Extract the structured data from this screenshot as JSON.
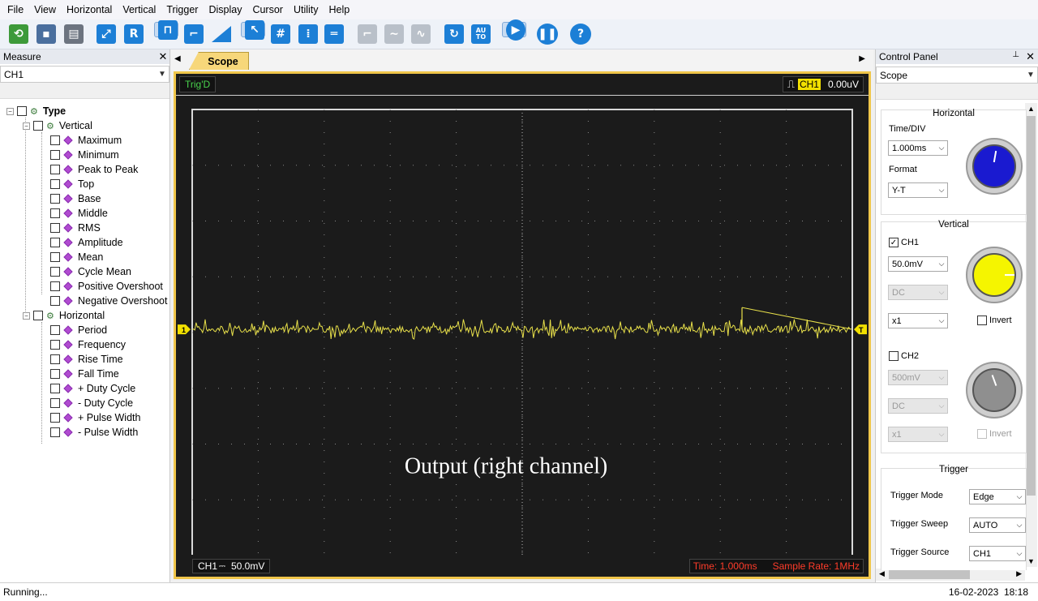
{
  "menu": [
    "File",
    "View",
    "Horizontal",
    "Vertical",
    "Trigger",
    "Display",
    "Cursor",
    "Utility",
    "Help"
  ],
  "toolbar_icons": [
    "open-icon",
    "save-icon",
    "print-icon",
    "autoscale-icon",
    "reset-icon",
    "pulse-icon",
    "step-icon",
    "ramp-icon",
    "pointer-icon",
    "grid-icon",
    "vertical-cursor-icon",
    "horizontal-cursor-icon",
    "step-gray-icon",
    "wave-gray-icon",
    "sine-gray-icon",
    "refresh-icon",
    "auto-icon",
    "run-icon",
    "pause-icon",
    "help-icon"
  ],
  "toolbar_labels": {
    "reset": "R",
    "auto": "AU\nTO",
    "help": "?"
  },
  "measure": {
    "title": "Measure",
    "channel": "CH1",
    "root": "Type",
    "vertical_label": "Vertical",
    "vertical_items": [
      "Maximum",
      "Minimum",
      "Peak to Peak",
      "Top",
      "Base",
      "Middle",
      "RMS",
      "Amplitude",
      "Mean",
      "Cycle Mean",
      "Positive Overshoot",
      "Negative Overshoot"
    ],
    "horizontal_label": "Horizontal",
    "horizontal_items": [
      "Period",
      "Frequency",
      "Rise Time",
      "Fall Time",
      "+ Duty Cycle",
      "- Duty Cycle",
      "+ Pulse Width",
      "- Pulse Width"
    ]
  },
  "scope": {
    "tab_label": "Scope",
    "trig_status": "Trig'D",
    "trig_channel": "CH1",
    "trig_value": "0.00uV",
    "ch_marker": "1",
    "trig_marker": "T",
    "overlay_text": "Output (right channel)",
    "bottom_ch": "CH1",
    "bottom_ch_coupling": "⎓",
    "bottom_volts": "50.0mV",
    "time_label": "Time: 1.000ms",
    "sample_rate_label": "Sample Rate: 1MHz",
    "colors": {
      "trace": "#e8e04a",
      "grid": "#8a8a8a",
      "frame": "#f0c64a",
      "red_text": "#ff3c2a"
    }
  },
  "control": {
    "title": "Control Panel",
    "mode": "Scope",
    "horizontal_title": "Horizontal",
    "timediv_label": "Time/DIV",
    "timediv_value": "1.000ms",
    "format_label": "Format",
    "format_value": "Y-T",
    "vertical_title": "Vertical",
    "ch1_label": "CH1",
    "ch1_volts": "50.0mV",
    "ch1_coupling": "DC",
    "ch1_probe": "x1",
    "invert_label": "Invert",
    "ch2_label": "CH2",
    "ch2_volts": "500mV",
    "ch2_coupling": "DC",
    "ch2_probe": "x1",
    "trigger_title": "Trigger",
    "trigger_mode_label": "Trigger Mode",
    "trigger_mode_value": "Edge",
    "trigger_sweep_label": "Trigger Sweep",
    "trigger_sweep_value": "AUTO",
    "trigger_source_label": "Trigger Source",
    "trigger_source_value": "CH1"
  },
  "status": {
    "text": "Running...",
    "datetime": "16-02-2023  18:18"
  }
}
